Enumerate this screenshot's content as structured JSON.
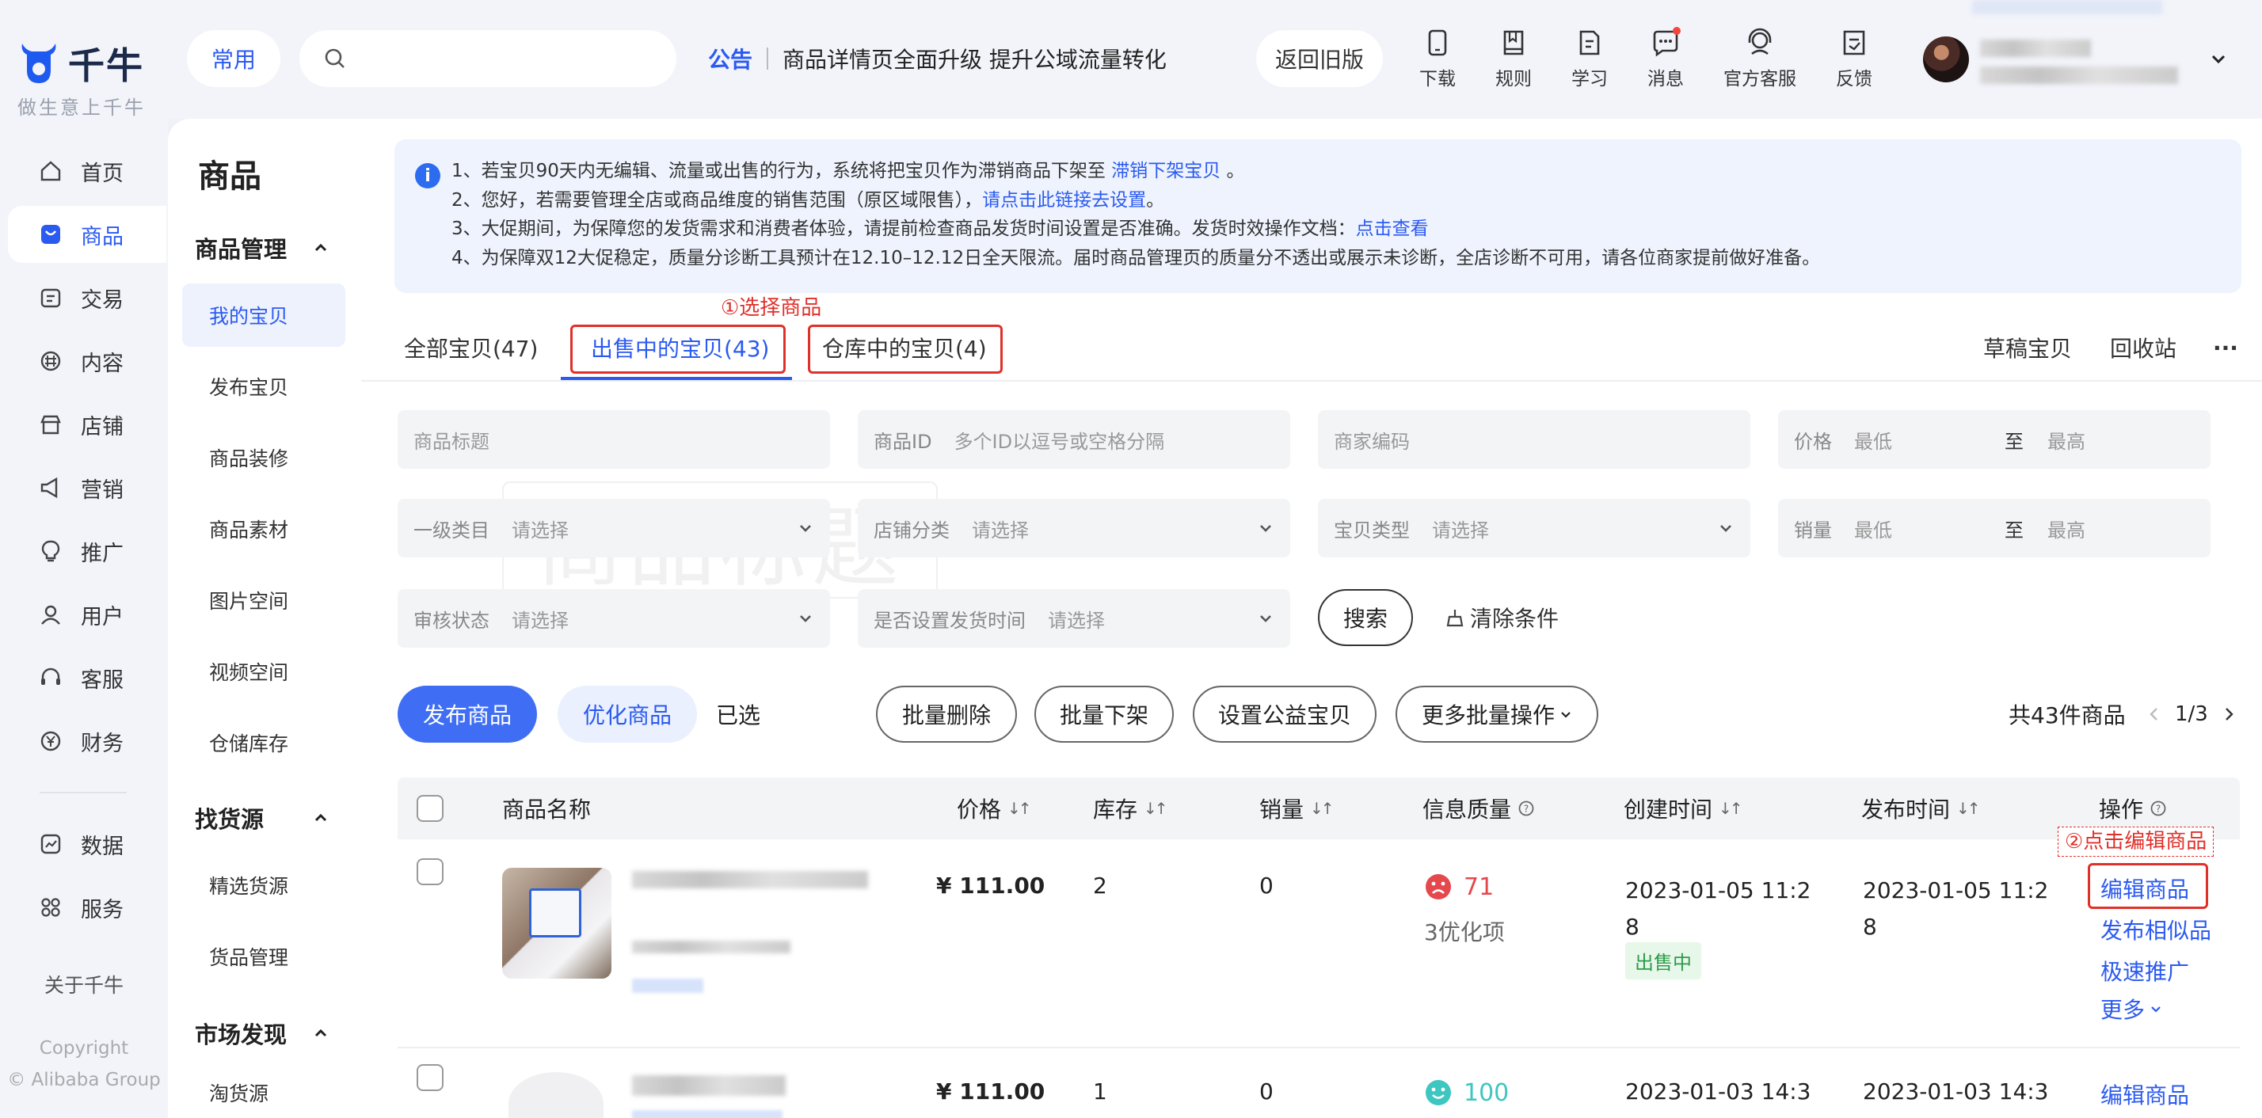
{
  "brand": {
    "name": "千牛",
    "slogan": "做生意上千牛"
  },
  "leftnav": {
    "items": [
      {
        "label": "首页",
        "icon": "home-icon"
      },
      {
        "label": "商品",
        "icon": "goods-icon",
        "active": true
      },
      {
        "label": "交易",
        "icon": "trade-icon"
      },
      {
        "label": "内容",
        "icon": "content-icon"
      },
      {
        "label": "店铺",
        "icon": "shop-icon"
      },
      {
        "label": "营销",
        "icon": "megaphone-icon"
      },
      {
        "label": "推广",
        "icon": "bulb-icon"
      },
      {
        "label": "用户",
        "icon": "user-icon"
      },
      {
        "label": "客服",
        "icon": "headset-icon"
      },
      {
        "label": "财务",
        "icon": "yuan-icon"
      },
      {
        "label": "数据",
        "icon": "chart-icon"
      },
      {
        "label": "服务",
        "icon": "grid-icon"
      }
    ],
    "about": "关于千牛",
    "copyright1": "Copyright",
    "copyright2": "© Alibaba Group"
  },
  "topbar": {
    "common": "常用",
    "notice_tag": "公告",
    "notice_text": "商品详情页全面升级 提升公域流量转化",
    "back_old": "返回旧版",
    "tools": [
      {
        "label": "下载",
        "icon": "phone-icon"
      },
      {
        "label": "规则",
        "icon": "book-icon"
      },
      {
        "label": "学习",
        "icon": "study-icon"
      },
      {
        "label": "消息",
        "icon": "message-icon"
      },
      {
        "label": "官方客服",
        "icon": "service-icon"
      },
      {
        "label": "反馈",
        "icon": "feedback-icon"
      }
    ]
  },
  "subnav": {
    "title": "商品",
    "groups": [
      {
        "label": "商品管理",
        "items": [
          "我的宝贝",
          "发布宝贝",
          "商品装修",
          "商品素材",
          "图片空间",
          "视频空间",
          "仓储库存"
        ]
      },
      {
        "label": "找货源",
        "items": [
          "精选货源",
          "货品管理"
        ]
      },
      {
        "label": "市场发现",
        "items": [
          "淘货源"
        ]
      }
    ]
  },
  "info": {
    "line1_pre": "1、若宝贝90天内无编辑、流量或出售的行为，系统将把宝贝作为滞销商品下架至 ",
    "line1_link": "滞销下架宝贝",
    "line1_post": " 。",
    "line2_pre": "2、您好，若需要管理全店或商品维度的销售范围（原区域限售），",
    "line2_link": "请点击此链接去设置",
    "line2_post": "。",
    "line3_pre": "3、大促期间，为保障您的发货需求和消费者体验，请提前检查商品发货时间设置是否准确。发货时效操作文档：",
    "line3_link": "点击查看",
    "line4": "4、为保障双12大促稳定，质量分诊断工具预计在12.10–12.12日全天限流。届时商品管理页的质量分不透出或展示未诊断，全店诊断不可用，请各位商家提前做好准备。"
  },
  "tabs": {
    "all": "全部宝贝(47)",
    "selling": "出售中的宝贝(43)",
    "warehouse": "仓库中的宝贝(4)",
    "draft": "草稿宝贝",
    "recycle": "回收站",
    "more": "···"
  },
  "annotations": {
    "step1": "①选择商品",
    "step2": "②点击编辑商品"
  },
  "filters": {
    "title_ph": "商品标题",
    "id_label": "商品ID",
    "id_ph": "多个ID以逗号或空格分隔",
    "code_ph": "商家编码",
    "price_label": "价格",
    "min": "最低",
    "to": "至",
    "max": "最高",
    "cat_label": "一级类目",
    "select": "请选择",
    "shopcat_label": "店铺分类",
    "type_label": "宝贝类型",
    "sales_label": "销量",
    "audit_label": "审核状态",
    "ship_label": "是否设置发货时间",
    "search_btn": "搜索",
    "clear_btn": "清除条件",
    "watermark": "商品标题"
  },
  "actions": {
    "publish": "发布商品",
    "optimize": "优化商品",
    "selected": "已选",
    "batch_delete": "批量删除",
    "batch_off": "批量下架",
    "charity": "设置公益宝贝",
    "more_batch": "更多批量操作",
    "total": "共43件商品",
    "page": "1/3"
  },
  "table": {
    "headers": {
      "name": "商品名称",
      "price": "价格",
      "stock": "库存",
      "sales": "销量",
      "quality": "信息质量",
      "created": "创建时间",
      "published": "发布时间",
      "ops": "操作"
    },
    "rows": [
      {
        "price": "¥ 111.00",
        "stock": "2",
        "sales": "0",
        "score": "71",
        "score_note": "3优化项",
        "created_a": "2023-01-05 11:2",
        "created_b": "8",
        "published_a": "2023-01-05 11:2",
        "published_b": "8",
        "status": "出售中",
        "ops": [
          "编辑商品",
          "发布相似品",
          "极速推广",
          "更多"
        ]
      },
      {
        "price": "¥ 111.00",
        "stock": "1",
        "sales": "0",
        "score": "100",
        "created_a": "2023-01-03 14:3",
        "published_a": "2023-01-03 14:3",
        "ops": [
          "编辑商品"
        ]
      }
    ]
  },
  "colors": {
    "accent": "#2b5af0",
    "annotation": "#e0302a",
    "bad": "#e5484d",
    "good": "#3ec6c0"
  }
}
